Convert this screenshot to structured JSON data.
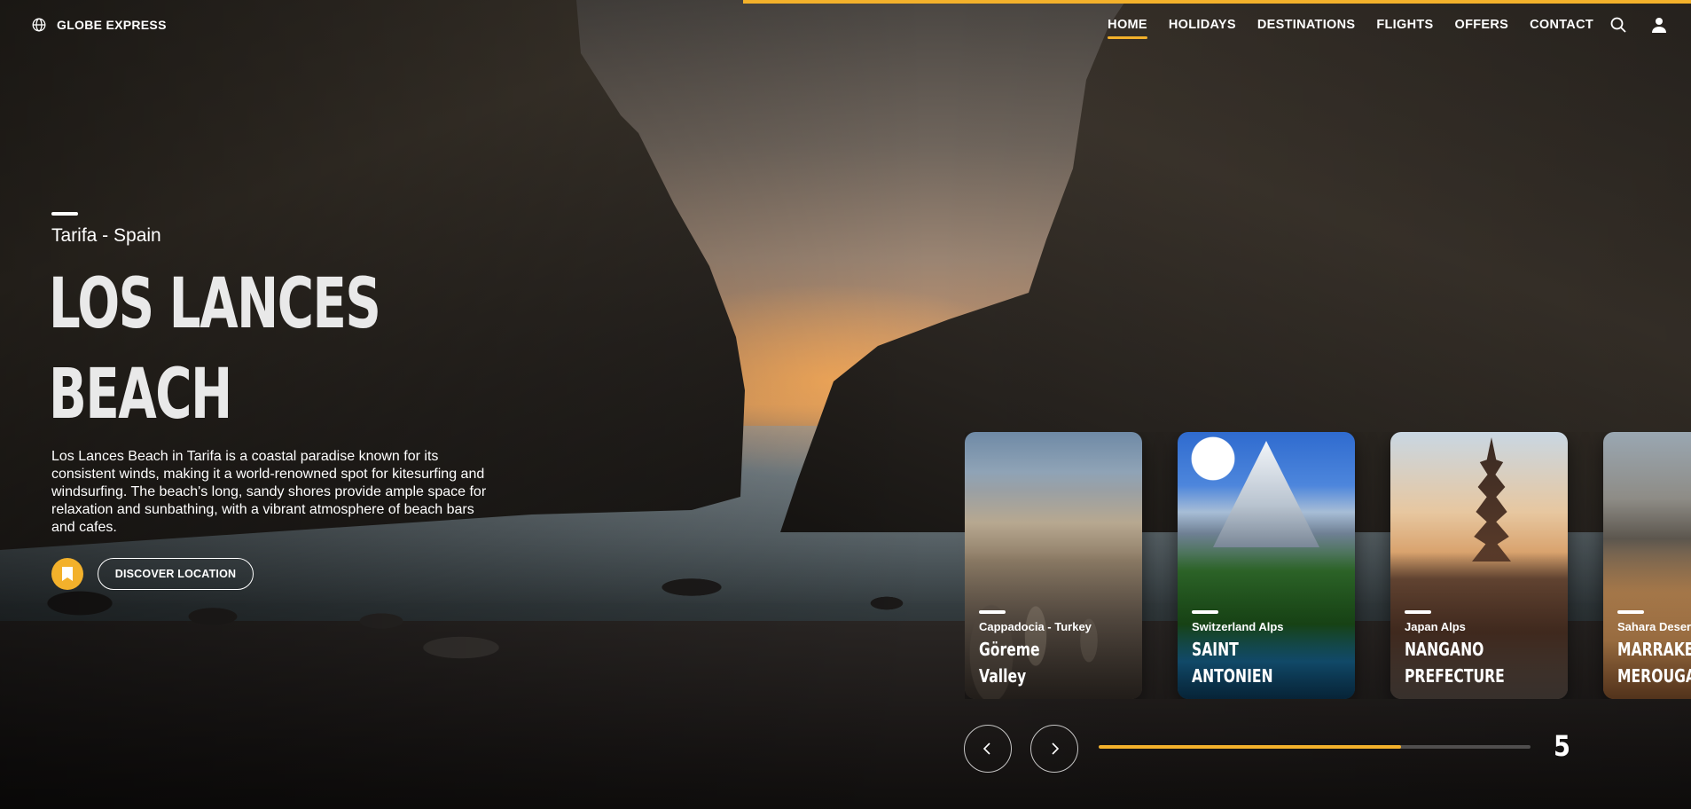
{
  "brand": {
    "name": "GLOBE EXPRESS",
    "icon": "globe-icon"
  },
  "nav": {
    "items": [
      {
        "label": "HOME",
        "active": true
      },
      {
        "label": "HOLIDAYS",
        "active": false
      },
      {
        "label": "DESTINATIONS",
        "active": false
      },
      {
        "label": "FLIGHTS",
        "active": false
      },
      {
        "label": "OFFERS",
        "active": false
      },
      {
        "label": "CONTACT",
        "active": false
      }
    ],
    "icons": [
      "search-icon",
      "user-icon"
    ]
  },
  "hero": {
    "location": "Tarifa - Spain",
    "title_line1": "LOS LANCES",
    "title_line2": "BEACH",
    "description": "Los Lances Beach in Tarifa is a coastal paradise known for its consistent winds, making it a world-renowned spot for kitesurfing and windsurfing. The beach's long, sandy shores provide ample space for relaxation and sunbathing, with a vibrant atmosphere of beach bars and cafes.",
    "bookmark_icon": "bookmark-icon",
    "cta_label": "DISCOVER LOCATION"
  },
  "cards": [
    {
      "subtitle": "Cappadocia - Turkey",
      "title_line1": "Göreme",
      "title_line2": "Valley"
    },
    {
      "subtitle": "Switzerland Alps",
      "title_line1": "SAINT",
      "title_line2": "ANTONIEN"
    },
    {
      "subtitle": "Japan Alps",
      "title_line1": "NANGANO",
      "title_line2": "PREFECTURE"
    },
    {
      "subtitle": "Sahara Desert - Morocco",
      "title_line1": "MARRAKECH",
      "title_line2": "MEROUGA"
    }
  ],
  "slider": {
    "prev_icon": "chevron-left-icon",
    "next_icon": "chevron-right-icon",
    "progress_fraction": 0.7,
    "current_slide": "5"
  },
  "colors": {
    "accent": "#f3b12b",
    "text": "#ffffff"
  }
}
